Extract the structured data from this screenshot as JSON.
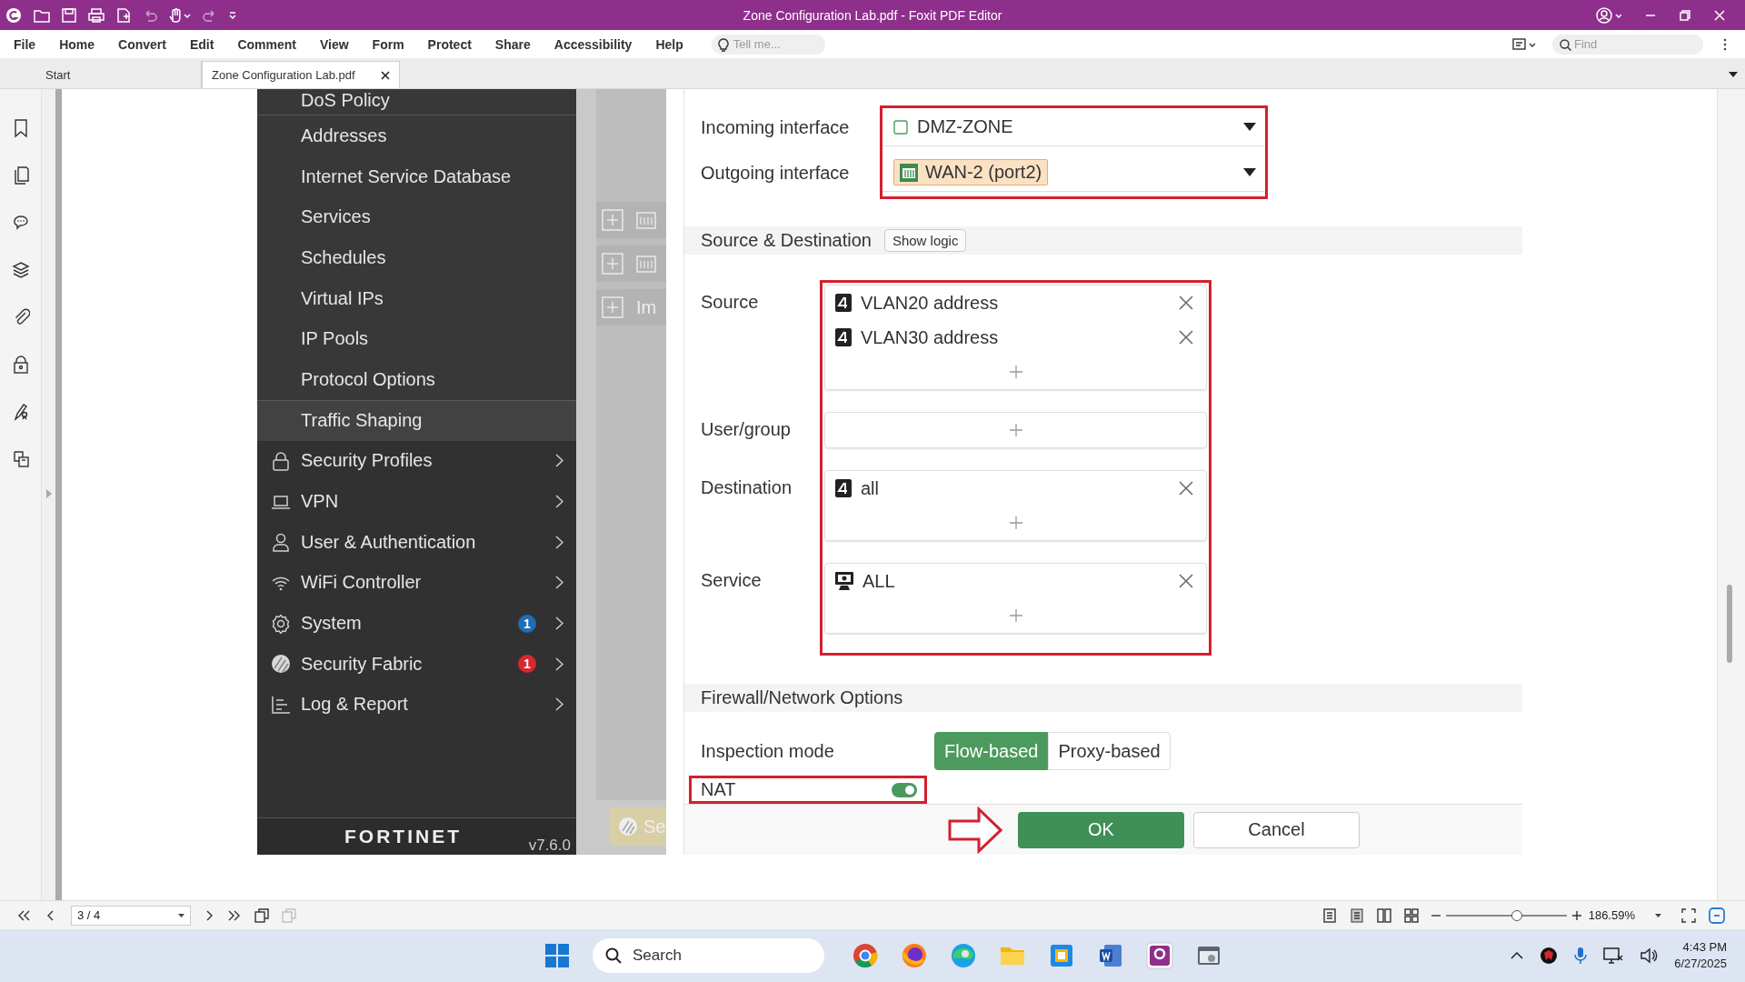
{
  "window": {
    "title": "Zone Configuration Lab.pdf - Foxit PDF Editor"
  },
  "menu": [
    "File",
    "Home",
    "Convert",
    "Edit",
    "Comment",
    "View",
    "Form",
    "Protect",
    "Share",
    "Accessibility",
    "Help"
  ],
  "tell_me": {
    "placeholder": "Tell me..."
  },
  "find": {
    "placeholder": "Find"
  },
  "tabs": [
    {
      "label": "Start",
      "selected": false
    },
    {
      "label": "Zone Configuration Lab.pdf",
      "selected": true
    }
  ],
  "document": {
    "sidebar": {
      "items": [
        {
          "label": "DoS Policy",
          "kind": "sub",
          "selected": false
        },
        {
          "label": "Addresses",
          "kind": "sub",
          "selected": false
        },
        {
          "label": "Internet Service Database",
          "kind": "sub",
          "selected": false
        },
        {
          "label": "Services",
          "kind": "sub",
          "selected": false
        },
        {
          "label": "Schedules",
          "kind": "sub",
          "selected": false
        },
        {
          "label": "Virtual IPs",
          "kind": "sub",
          "selected": false
        },
        {
          "label": "IP Pools",
          "kind": "sub",
          "selected": false
        },
        {
          "label": "Protocol Options",
          "kind": "sub",
          "selected": false
        },
        {
          "label": "Traffic Shaping",
          "kind": "sub",
          "selected": true
        },
        {
          "label": "Security Profiles",
          "kind": "group",
          "selected": false
        },
        {
          "label": "VPN",
          "kind": "group",
          "selected": false
        },
        {
          "label": "User & Authentication",
          "kind": "group",
          "selected": false
        },
        {
          "label": "WiFi Controller",
          "kind": "group",
          "selected": false
        },
        {
          "label": "System",
          "kind": "group",
          "selected": false,
          "badge": {
            "text": "1",
            "color": "#1f6db3"
          }
        },
        {
          "label": "Security Fabric",
          "kind": "group",
          "selected": false,
          "badge": {
            "text": "1",
            "color": "#d8282c"
          }
        },
        {
          "label": "Log & Report",
          "kind": "group",
          "selected": false
        }
      ],
      "logo": "FORTINET",
      "version": "v7.6.0"
    },
    "background_panel": {
      "row_label": "Im",
      "bottom_button": "Se"
    },
    "policy_form": {
      "interfaces": [
        {
          "label": "Incoming interface",
          "value": "DMZ-ZONE",
          "kind": "zone"
        },
        {
          "label": "Outgoing interface",
          "value": "WAN-2 (port2)",
          "kind": "port"
        }
      ],
      "source_destination": {
        "title": "Source & Destination",
        "button": "Show logic",
        "fields": [
          {
            "label": "Source",
            "entries": [
              {
                "text": "VLAN20 address",
                "kind": "address"
              },
              {
                "text": "VLAN30 address",
                "kind": "address"
              }
            ]
          },
          {
            "label": "User/group"
          },
          {
            "label": "Destination",
            "entries": [
              {
                "text": "all",
                "kind": "address"
              }
            ]
          },
          {
            "label": "Service",
            "entries": [
              {
                "text": "ALL",
                "kind": "service"
              }
            ]
          }
        ]
      },
      "firewall_options": {
        "title": "Firewall/Network Options",
        "inspection_mode": {
          "label": "Inspection mode",
          "options": [
            {
              "label": "Flow-based",
              "selected": true
            },
            {
              "label": "Proxy-based",
              "selected": false
            }
          ]
        },
        "nat": {
          "label": "NAT",
          "on": true
        }
      },
      "buttons": [
        {
          "label": "OK",
          "kind": "primary"
        },
        {
          "label": "Cancel",
          "kind": "secondary"
        }
      ]
    }
  },
  "status_bar": {
    "page": "3 / 4",
    "zoom": {
      "value": "186.59%",
      "level": 0.6
    }
  },
  "taskbar": {
    "search": {
      "placeholder": "Search"
    },
    "time": "4:43 PM",
    "date": "6/27/2025"
  }
}
